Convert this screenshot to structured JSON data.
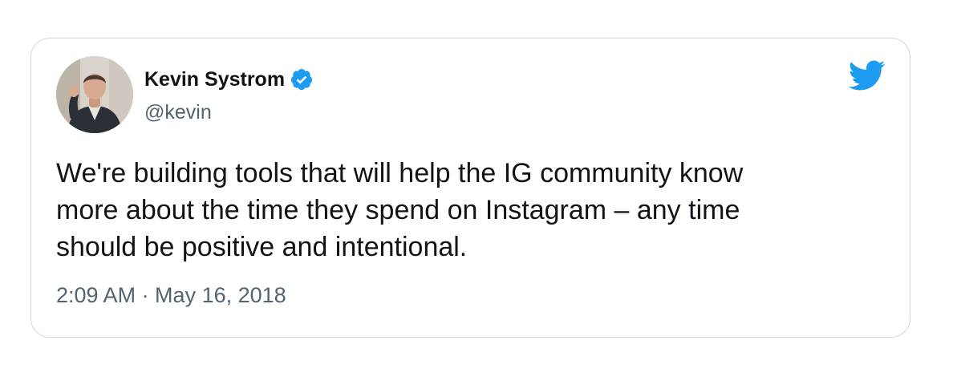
{
  "tweet": {
    "author": {
      "display_name": "Kevin Systrom",
      "handle": "@kevin",
      "verified": true
    },
    "text_lines": [
      "We're building tools that will help the IG community know",
      "more about the time they spend on Instagram – any time",
      "should be positive and intentional."
    ],
    "timestamp": "2:09 AM · May 16, 2018"
  },
  "icons": {
    "verified": "verified-badge-icon",
    "brand": "twitter-bird-icon"
  },
  "colors": {
    "text_primary": "#0f1419",
    "text_secondary": "#536471",
    "brand_blue": "#1d9bf0",
    "border": "#cfd9de"
  }
}
